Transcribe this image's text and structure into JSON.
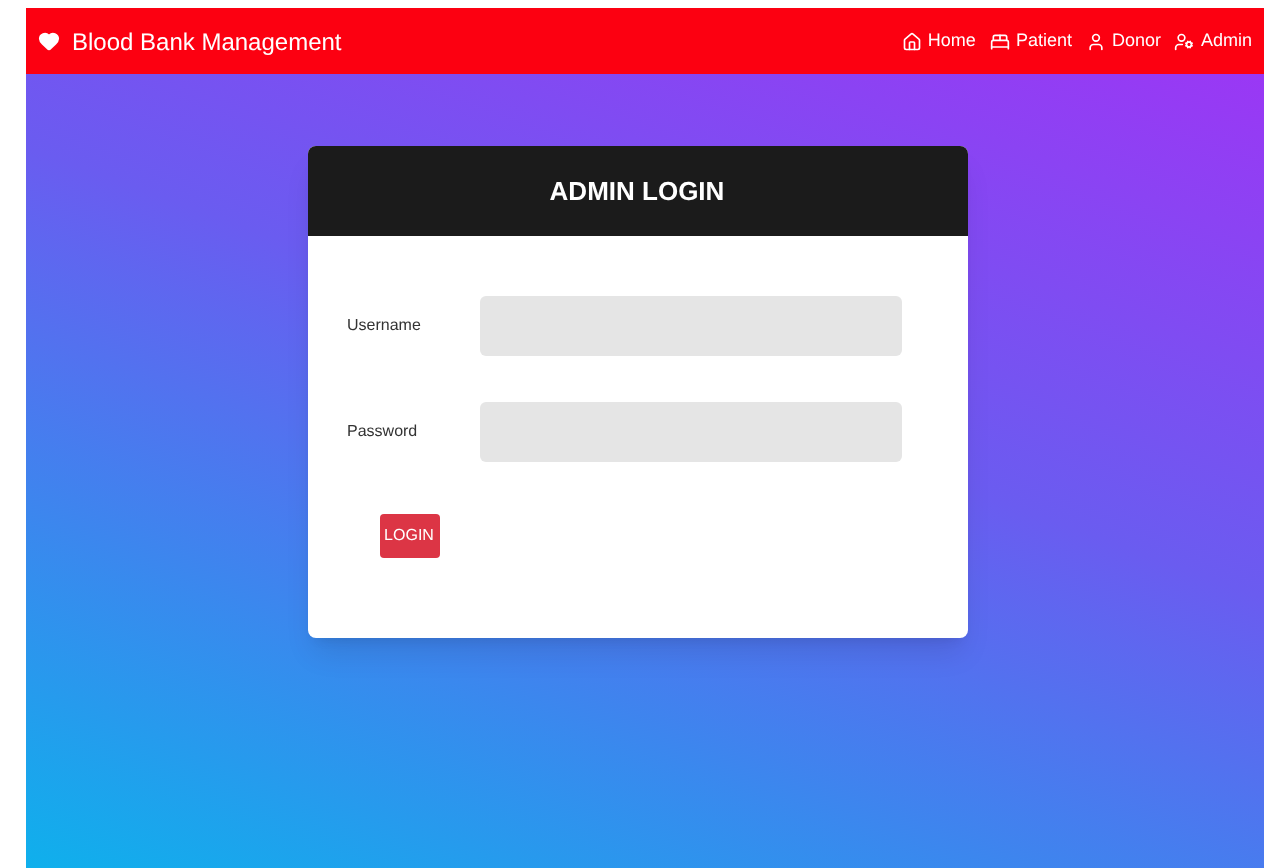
{
  "navbar": {
    "brand": "Blood Bank Management",
    "links": [
      {
        "kind": "home",
        "label": "Home"
      },
      {
        "kind": "patient",
        "label": "Patient"
      },
      {
        "kind": "donor",
        "label": "Donor"
      },
      {
        "kind": "admin",
        "label": "Admin"
      }
    ]
  },
  "login": {
    "title": "ADMIN LOGIN",
    "fields": [
      {
        "label": "Username"
      },
      {
        "label": "Password"
      }
    ],
    "button": "LOGIN"
  }
}
